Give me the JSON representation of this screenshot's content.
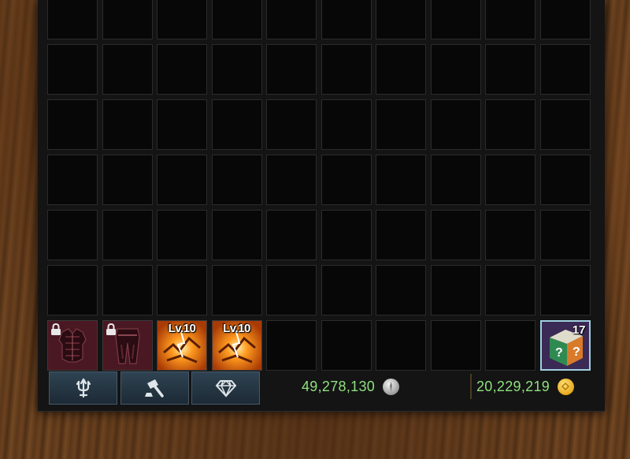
{
  "inventory": {
    "rows": 7,
    "columns": 10,
    "items": [
      {
        "slot": 60,
        "icon": "armor-chest-icon",
        "locked": true,
        "level": "",
        "count": ""
      },
      {
        "slot": 61,
        "icon": "armor-legs-icon",
        "locked": true,
        "level": "",
        "count": ""
      },
      {
        "slot": 62,
        "icon": "fire-rune-icon",
        "locked": false,
        "level": "Lv.10",
        "count": ""
      },
      {
        "slot": 63,
        "icon": "fire-rune-icon",
        "locked": false,
        "level": "Lv.10",
        "count": ""
      },
      {
        "slot": 69,
        "icon": "mystery-box-icon",
        "locked": false,
        "level": "",
        "count": "17"
      }
    ]
  },
  "toolbar": {
    "buttons": [
      {
        "name": "trident-button",
        "icon": "trident-icon"
      },
      {
        "name": "disassemble-button",
        "icon": "hammer-icon"
      },
      {
        "name": "gem-button",
        "icon": "diamond-icon"
      }
    ]
  },
  "currency": {
    "silver": "49,278,130",
    "gold": "20,229,219"
  },
  "colors": {
    "currency_text": "#8fe07f",
    "highlight_border": "#9fd0e0",
    "button_bg": "#2f4352"
  }
}
